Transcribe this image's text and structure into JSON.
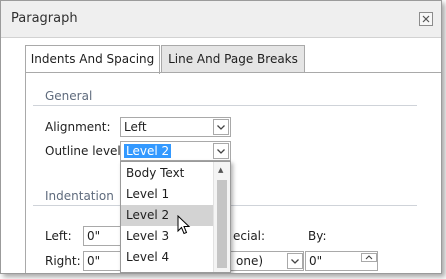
{
  "dialog": {
    "title": "Paragraph",
    "close_label": "✕"
  },
  "tabs": [
    {
      "label": "Indents And Spacing",
      "active": true
    },
    {
      "label": "Line And Page Breaks",
      "active": false
    }
  ],
  "general": {
    "heading": "General",
    "alignment_label": "Alignment:",
    "alignment_value": "Left",
    "outline_label": "Outline level:",
    "outline_value": "Level 2"
  },
  "indentation": {
    "heading": "Indentation",
    "left_label": "Left:",
    "left_value": "0\"",
    "right_label": "Right:",
    "right_value": "0\"",
    "special_label_partial": "ecial:",
    "special_value_partial": "one)",
    "by_label": "By:",
    "by_value": "0\""
  },
  "outline_dropdown": {
    "options": [
      "Body Text",
      "Level 1",
      "Level 2",
      "Level 3",
      "Level 4"
    ],
    "hovered": "Level 2"
  },
  "colors": {
    "selection": "#3399ff",
    "section_heading": "#5f6b7d",
    "hover": "#d3d3d3"
  }
}
